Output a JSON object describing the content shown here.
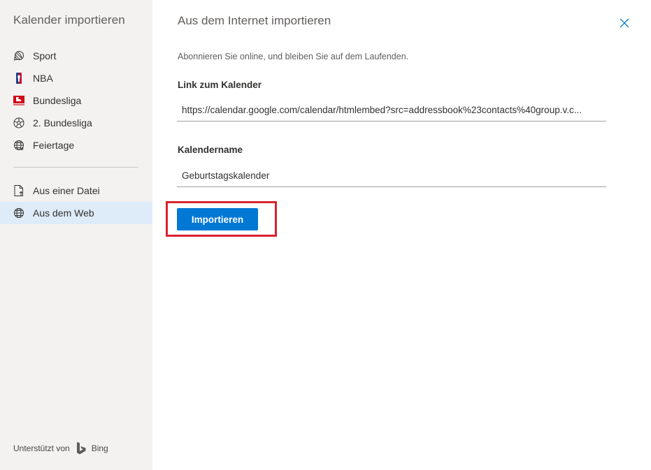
{
  "sidebar": {
    "title": "Kalender importieren",
    "items": [
      {
        "label": "Sport",
        "icon": "sport-ball-icon"
      },
      {
        "label": "NBA",
        "icon": "nba-logo-icon"
      },
      {
        "label": "Bundesliga",
        "icon": "bundesliga-logo-icon"
      },
      {
        "label": "2. Bundesliga",
        "icon": "soccer-ball-icon"
      },
      {
        "label": "Feiertage",
        "icon": "globe-star-icon"
      }
    ],
    "import_items": [
      {
        "label": "Aus einer Datei",
        "icon": "file-upload-icon",
        "selected": false
      },
      {
        "label": "Aus dem Web",
        "icon": "globe-icon",
        "selected": true
      }
    ],
    "footer": {
      "prefix": "Unterstützt von",
      "brand": "Bing"
    }
  },
  "panel": {
    "title": "Aus dem Internet importieren",
    "subtitle": "Abonnieren Sie online, und bleiben Sie auf dem Laufenden.",
    "link_label": "Link zum Kalender",
    "link_value": "https://calendar.google.com/calendar/htmlembed?src=addressbook%23contacts%40group.v.c...",
    "name_label": "Kalendername",
    "name_value": "Geburtstagskalender",
    "import_button": "Importieren"
  },
  "colors": {
    "accent": "#0078d4",
    "highlight": "#d9232e",
    "sidebar_bg": "#f3f2f1",
    "selected_bg": "#deecf9"
  }
}
